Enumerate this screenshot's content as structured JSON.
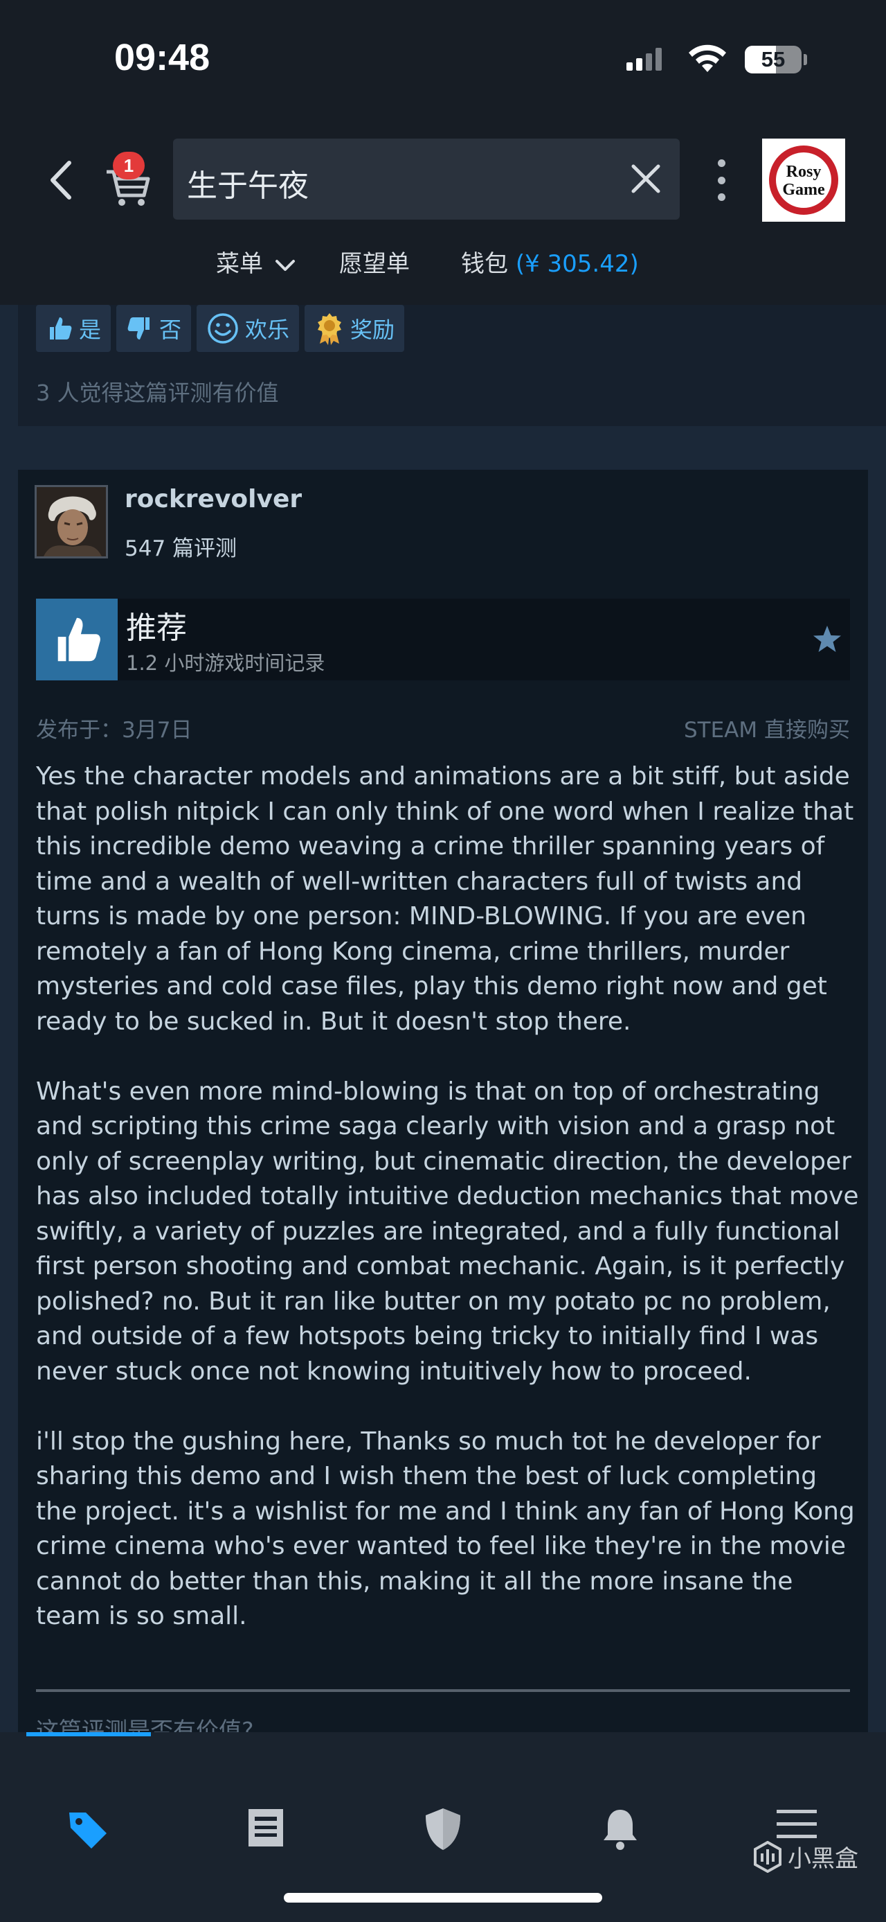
{
  "status_bar": {
    "time": "09:48",
    "battery": "55",
    "battery_level": 0.55
  },
  "header": {
    "cart_badge": "1",
    "search_value": "生于午夜",
    "logo_text_line1": "Rosy",
    "logo_text_line2": "Game"
  },
  "subnav": {
    "menu_label": "菜单",
    "wishlist_label": "愿望单",
    "wallet_label": "钱包",
    "wallet_amount": "(¥ 305.42)"
  },
  "prev_review": {
    "buttons": {
      "yes": "是",
      "no": "否",
      "funny": "欢乐",
      "award": "奖励"
    },
    "helpful_count_text": "3 人觉得这篇评测有价值"
  },
  "review": {
    "author_name": "rockrevolver",
    "author_review_count": "547 篇评测",
    "verdict": "推荐",
    "hours": "1.2 小时游戏时间记录",
    "posted": "发布于：3月7日",
    "source": "STEAM 直接购买",
    "paragraphs": [
      "Yes the character models and animations are a bit stiff, but aside that polish nitpick I can only think of one word when I realize that this incredible demo weaving a crime thriller spanning years of time and a wealth of well-written characters full of twists and turns is made by one person: MIND-BLOWING. If you are even remotely a fan of Hong Kong cinema, crime thrillers, murder mysteries and cold case files, play this demo right now and get ready to be sucked in. But it doesn't stop there.",
      "What's even more mind-blowing is that on top of orchestrating and scripting this crime saga clearly with vision and a grasp not only of screenplay writing, but cinematic direction, the developer has also included totally intuitive deduction mechanics that move swiftly, a variety of puzzles are integrated, and a fully functional first person shooting and combat mechanic. Again, is it perfectly polished? no. But it ran like butter on my potato pc no problem, and outside of a few hotspots being tricky to initially find I was never stuck once not knowing intuitively how to proceed.",
      "i'll stop the gushing here, Thanks so much tot he developer for sharing this demo and I wish them the best of luck completing the project. it's a wishlist for me and I think any fan of Hong Kong crime cinema who's ever wanted to feel like they're in the movie cannot do better than this, making it all the more insane the team is so small."
    ],
    "helpful_question": "这篇评测是否有价值?"
  },
  "bottom_nav": {
    "items": [
      "store-tag-icon",
      "news-icon",
      "shield-icon",
      "bell-icon",
      "menu-icon"
    ],
    "active_index": 0
  },
  "watermark": "小黑盒",
  "colors": {
    "accent": "#1a9fff",
    "background": "#1b2838",
    "card": "#0f1923",
    "thumb": "#2b6fa0",
    "badge": "#e33a3a"
  }
}
